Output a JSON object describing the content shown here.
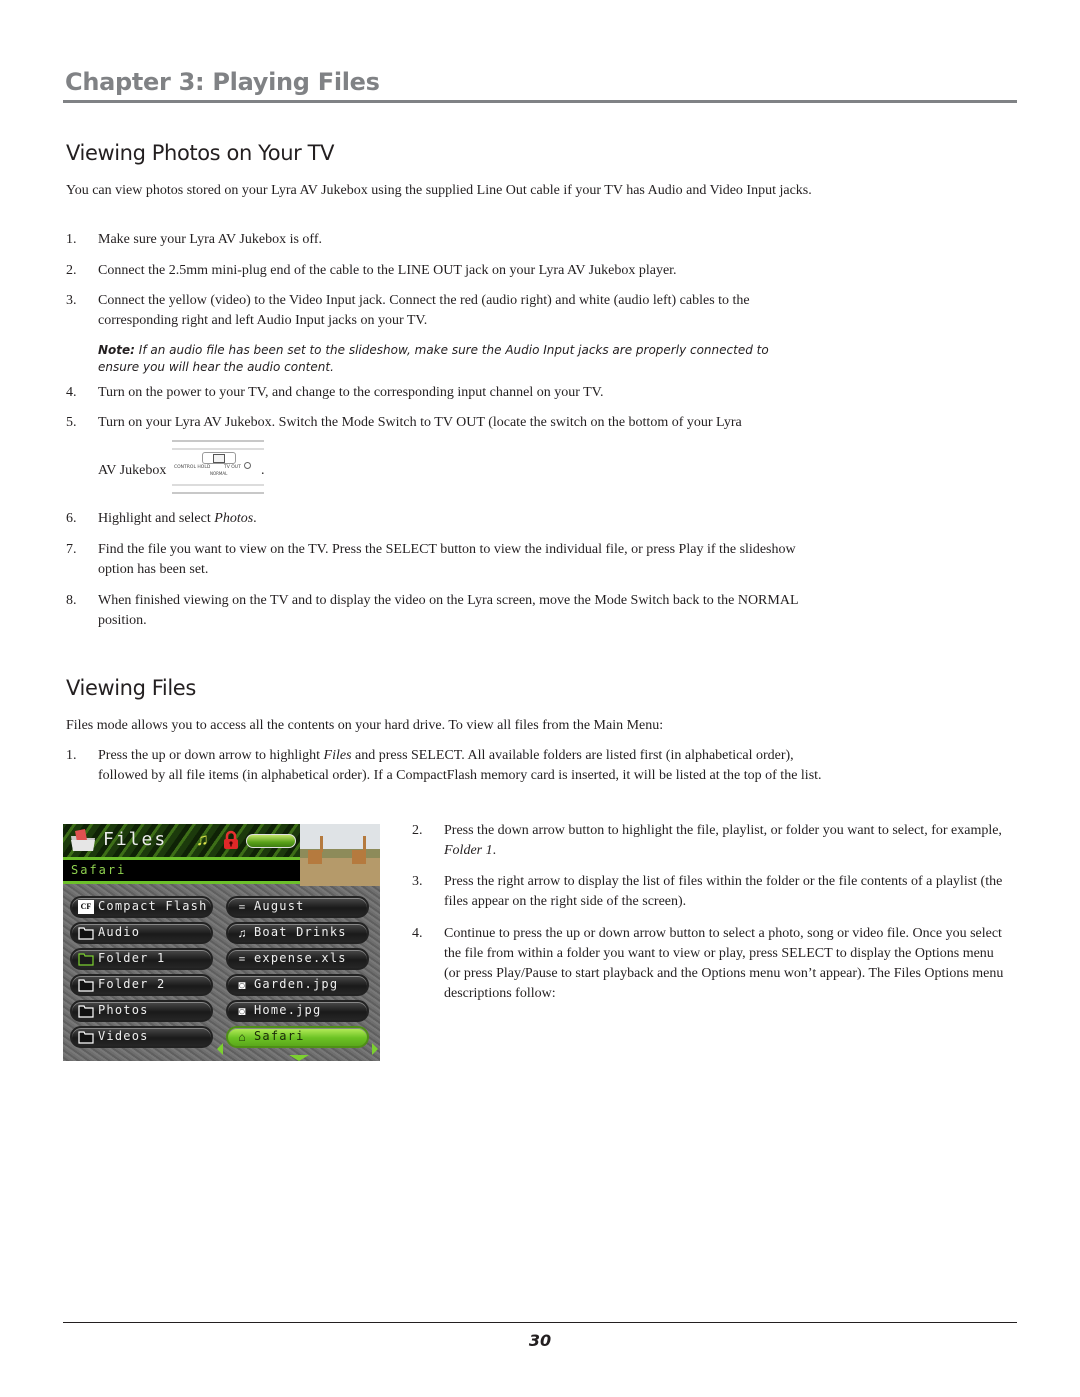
{
  "chapter": {
    "title": "Chapter 3: Playing Files"
  },
  "section_photos": {
    "title": "Viewing Photos on Your TV",
    "intro": "You can view photos stored on your Lyra AV Jukebox using the supplied Line Out cable if your TV has Audio and Video Input jacks.",
    "steps": [
      {
        "num": "1.",
        "text": "Make sure your Lyra AV Jukebox is off."
      },
      {
        "num": "2.",
        "text": "Connect the 2.5mm mini-plug end of the cable to the LINE OUT jack on your Lyra AV Jukebox player."
      },
      {
        "num": "3.",
        "text": "Connect the yellow (video) to the Video Input jack. Connect the red (audio right) and white (audio left) cables to the corresponding right and left Audio Input jacks on your TV."
      },
      {
        "num": "4.",
        "text": "Turn on the power to your TV, and change to the corresponding input channel on your TV."
      },
      {
        "num": "5.",
        "text": "Turn on your Lyra AV Jukebox. Switch the Mode Switch to TV OUT (locate the switch on the bottom of your Lyra",
        "text_cont": "AV Jukebox",
        "text_end": "."
      },
      {
        "num": "6.",
        "text_pre": "Highlight and select ",
        "text_em": "Photos",
        "text_post": "."
      },
      {
        "num": "7.",
        "text": "Find the file you want to view on the TV. Press the SELECT button to view the individual file, or press Play if the slideshow option has been set."
      },
      {
        "num": "8.",
        "text": "When finished viewing on the TV and to display the video on the Lyra screen, move the Mode Switch back to the NORMAL position."
      }
    ],
    "note": {
      "label": "Note:",
      "text": " If an audio file has been set to the slideshow, make sure the Audio Input jacks are properly connected to ensure you will hear the audio content."
    },
    "switch_labels": {
      "left": "CONTROL HOLD",
      "right": "TV OUT",
      "bottom": "NORMAL"
    }
  },
  "section_files": {
    "title": "Viewing Files",
    "intro": "Files mode allows you to access all the contents on your hard drive. To view all files from the Main Menu:",
    "steps": [
      {
        "num": "1.",
        "text_pre": "Press the up or down arrow to highlight ",
        "text_em": "Files",
        "text_post": " and press SELECT. All available folders are listed first (in alphabetical order), followed by all file items (in alphabetical order). If a CompactFlash memory card is inserted, it will be listed at the top of the list."
      },
      {
        "num": "2.",
        "text_pre": "Press the down arrow button to highlight the file, playlist, or folder you want to select, for example, ",
        "text_em": "Folder 1",
        "text_post": "."
      },
      {
        "num": "3.",
        "text": "Press the right arrow to display the list of files within the folder or the file contents of a playlist (the files appear on the right side of the screen)."
      },
      {
        "num": "4.",
        "text": "Continue to press the up or down arrow button to select a photo, song or video file. Once you select the file from within a folder you want to view or play, press SELECT to display the Options menu (or press Play/Pause to start playback and the Options menu won’t appear). The Files Options menu descriptions follow:"
      }
    ]
  },
  "device_screen": {
    "header_title": "Files",
    "current_folder": "Safari",
    "left_column": [
      {
        "label": "Compact Flash",
        "icon": "compactflash-icon",
        "glyph": "CF"
      },
      {
        "label": "Audio",
        "icon": "folder-icon",
        "glyph": ""
      },
      {
        "label": "Folder 1",
        "icon": "folder-open-icon",
        "glyph": ""
      },
      {
        "label": "Folder 2",
        "icon": "folder-icon",
        "glyph": ""
      },
      {
        "label": "Photos",
        "icon": "folder-icon",
        "glyph": ""
      },
      {
        "label": "Videos",
        "icon": "folder-icon",
        "glyph": ""
      }
    ],
    "right_column": [
      {
        "label": "August",
        "icon": "document-icon",
        "glyph": "≡"
      },
      {
        "label": "Boat Drinks",
        "icon": "music-note-icon",
        "glyph": "♫"
      },
      {
        "label": "expense.xls",
        "icon": "document-icon",
        "glyph": "≡"
      },
      {
        "label": "Garden.jpg",
        "icon": "camera-icon",
        "glyph": "◙"
      },
      {
        "label": "Home.jpg",
        "icon": "camera-icon",
        "glyph": "◙"
      },
      {
        "label": "Safari",
        "icon": "video-camera-icon",
        "glyph": "⌂",
        "selected": true
      }
    ],
    "colors": {
      "accent_green": "#6cc02a",
      "header_dark": "#1c3a0c"
    }
  },
  "footer": {
    "page_number": "30"
  }
}
